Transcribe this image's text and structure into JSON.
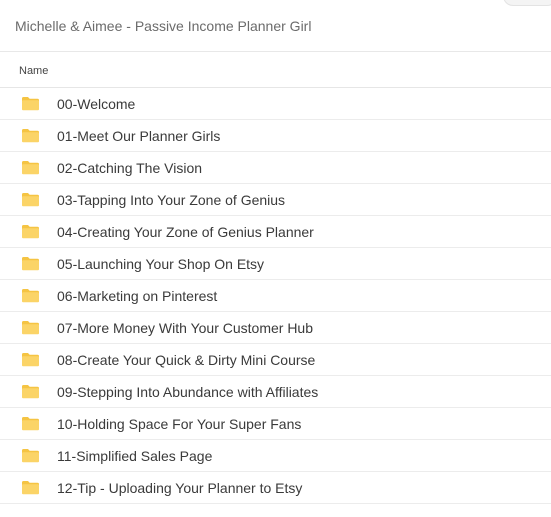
{
  "breadcrumb": "Michelle & Aimee - Passive Income Planner Girl",
  "header": {
    "name_column": "Name"
  },
  "colors": {
    "folder": "#fbd467",
    "folder_tab": "#f5c443"
  },
  "folders": [
    {
      "name": "00-Welcome",
      "icon": "folder-icon"
    },
    {
      "name": "01-Meet Our Planner Girls",
      "icon": "folder-icon"
    },
    {
      "name": "02-Catching The Vision",
      "icon": "folder-icon"
    },
    {
      "name": "03-Tapping Into Your Zone of Genius",
      "icon": "folder-icon"
    },
    {
      "name": "04-Creating Your Zone of Genius Planner",
      "icon": "folder-icon"
    },
    {
      "name": "05-Launching Your Shop On Etsy",
      "icon": "folder-icon"
    },
    {
      "name": "06-Marketing on Pinterest",
      "icon": "folder-icon"
    },
    {
      "name": "07-More Money With Your Customer Hub",
      "icon": "folder-icon"
    },
    {
      "name": "08-Create Your Quick & Dirty Mini Course",
      "icon": "folder-icon"
    },
    {
      "name": "09-Stepping Into Abundance with Affiliates",
      "icon": "folder-icon"
    },
    {
      "name": "10-Holding Space For Your Super Fans",
      "icon": "folder-icon"
    },
    {
      "name": "11-Simplified Sales Page",
      "icon": "folder-icon"
    },
    {
      "name": "12-Tip - Uploading Your Planner to Etsy",
      "icon": "folder-icon"
    }
  ]
}
